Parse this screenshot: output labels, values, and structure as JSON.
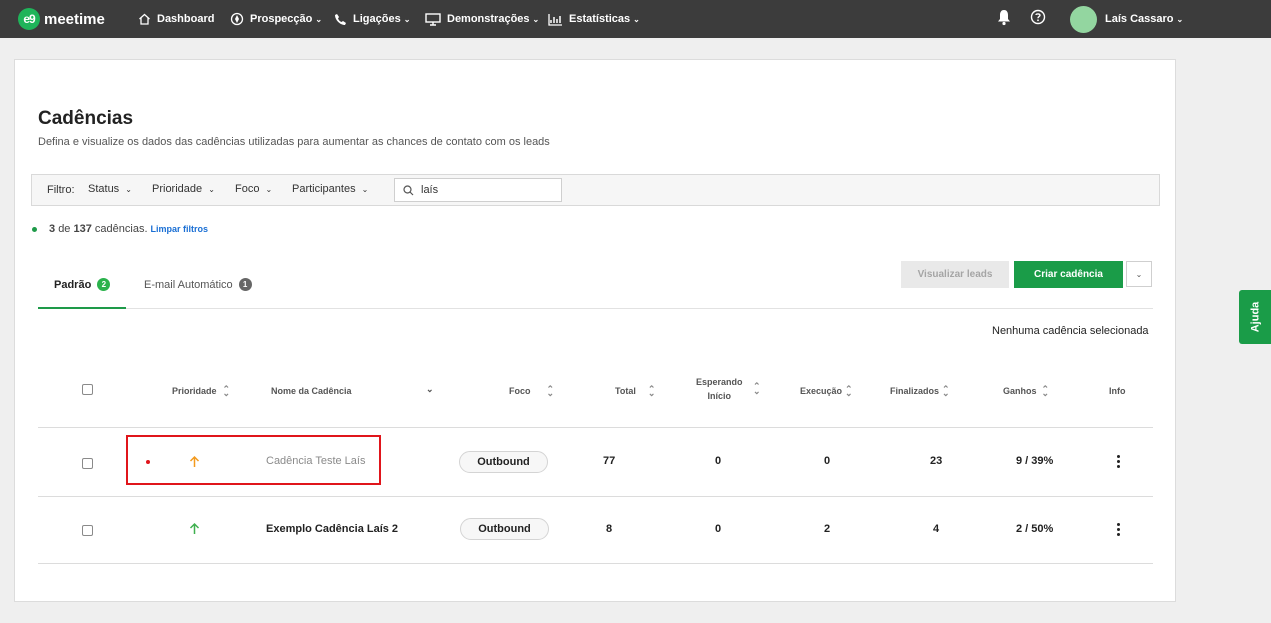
{
  "nav": {
    "logo_mark": "e9",
    "logo_text": "meetime",
    "items": [
      {
        "label": "Dashboard",
        "icon": "home-icon"
      },
      {
        "label": "Prospecção",
        "icon": "compass-icon"
      },
      {
        "label": "Ligações",
        "icon": "phone-icon"
      },
      {
        "label": "Demonstrações",
        "icon": "monitor-icon"
      },
      {
        "label": "Estatísticas",
        "icon": "chart-icon"
      }
    ],
    "user_name": "Laís Cassaro"
  },
  "page": {
    "title": "Cadências",
    "subtitle": "Defina e visualize os dados das cadências utilizadas para aumentar as chances de contato com os leads"
  },
  "filters": {
    "label": "Filtro:",
    "dropdowns": [
      "Status",
      "Prioridade",
      "Foco",
      "Participantes"
    ],
    "search_value": "laís"
  },
  "summary": {
    "shown": "3",
    "of_text": "de",
    "total": "137",
    "suffix": "cadências.",
    "clear_label": "Limpar filtros"
  },
  "tabs": [
    {
      "label": "Padrão",
      "count": "2",
      "badge_color": "#2bb24c"
    },
    {
      "label": "E-mail Automático",
      "count": "1",
      "badge_color": "#666666"
    }
  ],
  "actions": {
    "view_leads": "Visualizar leads",
    "create": "Criar cadência"
  },
  "selection_status": "Nenhuma cadência selecionada",
  "table": {
    "headers": {
      "priority": "Prioridade",
      "name": "Nome da Cadência",
      "focus": "Foco",
      "total": "Total",
      "waiting_line1": "Esperando",
      "waiting_line2": "Início",
      "execution": "Execução",
      "finished": "Finalizados",
      "gains": "Ganhos",
      "info": "Info"
    },
    "rows": [
      {
        "priority": "high",
        "priority_color": "#f39a1e",
        "name": "Cadência Teste Laís",
        "name_color": "#8a8a8a",
        "focus": "Outbound",
        "total": "77",
        "waiting": "0",
        "execution": "0",
        "finished": "23",
        "gains": "9 / 39%"
      },
      {
        "priority": "medium",
        "priority_color": "#3fb04f",
        "name": "Exemplo Cadência Laís 2",
        "name_color": "#222222",
        "focus": "Outbound",
        "total": "8",
        "waiting": "0",
        "execution": "2",
        "finished": "4",
        "gains": "2 / 50%"
      }
    ]
  },
  "help_tab": "Ajuda"
}
